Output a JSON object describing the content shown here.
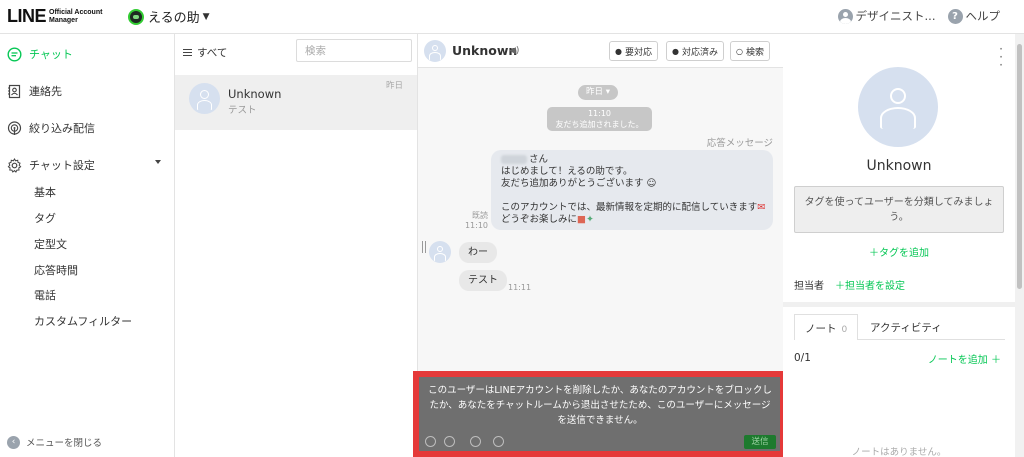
{
  "header": {
    "logo_main": "LINE",
    "logo_sub_1": "Official Account",
    "logo_sub_2": "Manager",
    "account_name": "えるの助",
    "user_name": "デザイニスト...",
    "help_label": "ヘルプ"
  },
  "sidebar": {
    "chat": "チャット",
    "contacts": "連絡先",
    "narrowcast": "絞り込み配信",
    "chat_settings": "チャット設定",
    "sub_items": [
      "基本",
      "タグ",
      "定型文",
      "応答時間",
      "電話",
      "カスタムフィルター"
    ],
    "close_menu": "メニューを閉じる"
  },
  "chat_list": {
    "filter_label": "すべて",
    "search_placeholder": "検索",
    "rows": [
      {
        "name": "Unknown",
        "preview": "テスト",
        "time": "昨日"
      }
    ]
  },
  "conversation": {
    "contact_name": "Unknown",
    "speaker_icon": "speaker-icon",
    "btn_follow_up": "要対応",
    "btn_resolved": "対応済み",
    "btn_search": "検索",
    "date_label": "昨日",
    "system_time": "11:10",
    "system_text": "友だち追加されました。",
    "auto_reply_label": "応答メッセージ",
    "greeting": {
      "suffix": "さん",
      "line1": "はじめまして！えるの助です。",
      "line2": "友だち追加ありがとうございます",
      "line3": "このアカウントでは、最新情報を定期的に配信していきます",
      "line4": "どうぞお楽しみに"
    },
    "read_label": "既読",
    "read_time": "11:10",
    "incoming": [
      {
        "text": "わー"
      },
      {
        "text": "テスト",
        "time": "11:11"
      }
    ],
    "blocked_text": "このユーザーはLINEアカウントを削除したか、あなたのアカウントをブロックしたか、あなたをチャットルームから退出させたため、このユーザーにメッセージを送信できません。",
    "send_label": "送信"
  },
  "profile": {
    "name": "Unknown",
    "tag_hint": "タグを使ってユーザーを分類してみましょう。",
    "add_tag": "＋タグを追加",
    "assignee_label": "担当者",
    "set_assignee": "＋担当者を設定",
    "tab_note": "ノート",
    "note_count": "0",
    "tab_activity": "アクティビティ",
    "note_fraction": "0/1",
    "add_note": "ノートを追加 ＋",
    "no_notes": "ノートはありません。"
  },
  "colors": {
    "line_green": "#06c755",
    "blocked_border": "#e53939",
    "avatar_bg": "#d6e0ef"
  }
}
